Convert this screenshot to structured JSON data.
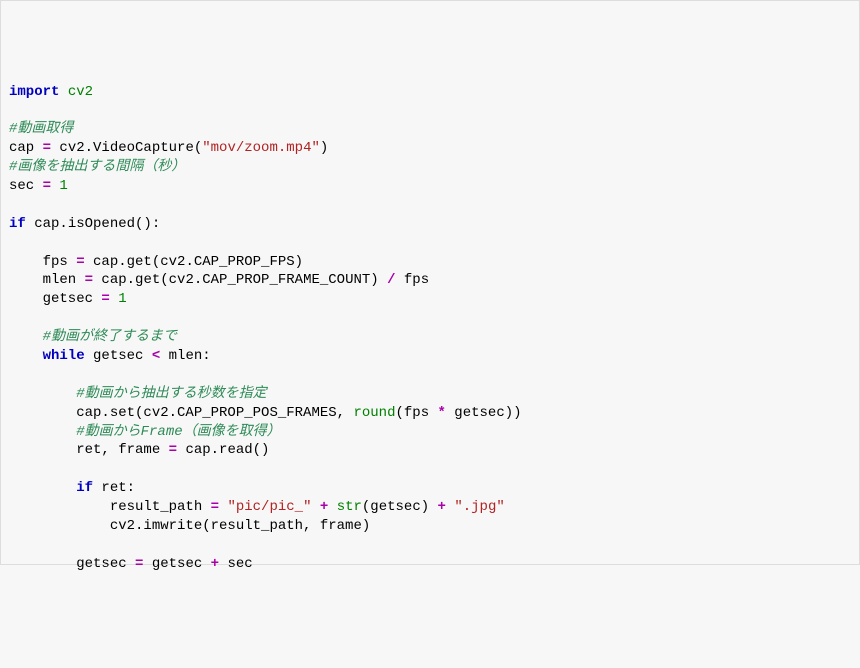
{
  "code": {
    "l1a": "import",
    "l1b": " cv2",
    "l2": "",
    "l3": "#動画取得",
    "l4a": "cap ",
    "l4b": "=",
    "l4c": " cv2.VideoCapture(",
    "l4d": "\"mov/zoom.mp4\"",
    "l4e": ")",
    "l5": "#画像を抽出する間隔（秒）",
    "l6a": "sec ",
    "l6b": "=",
    "l6c": " ",
    "l6d": "1",
    "l7": "",
    "l8a": "if",
    "l8b": " cap.isOpened():",
    "l9": "",
    "l10a": "    fps ",
    "l10b": "=",
    "l10c": " cap.get(cv2.CAP_PROP_FPS)",
    "l11a": "    mlen ",
    "l11b": "=",
    "l11c": " cap.get(cv2.CAP_PROP_FRAME_COUNT) ",
    "l11d": "/",
    "l11e": " fps",
    "l12a": "    getsec ",
    "l12b": "=",
    "l12c": " ",
    "l12d": "1",
    "l13": "",
    "l14": "    #動画が終了するまで",
    "l15a": "    ",
    "l15b": "while",
    "l15c": " getsec ",
    "l15d": "<",
    "l15e": " mlen:",
    "l16": "",
    "l17": "        #動画から抽出する秒数を指定",
    "l18a": "        cap.set(cv2.CAP_PROP_POS_FRAMES, ",
    "l18b": "round",
    "l18c": "(fps ",
    "l18d": "*",
    "l18e": " getsec))",
    "l19": "        #動画からFrame（画像を取得）",
    "l20a": "        ret, frame ",
    "l20b": "=",
    "l20c": " cap.read()",
    "l21": "",
    "l22a": "        ",
    "l22b": "if",
    "l22c": " ret:",
    "l23a": "            result_path ",
    "l23b": "=",
    "l23c": " ",
    "l23d": "\"pic/pic_\"",
    "l23e": " ",
    "l23f": "+",
    "l23g": " ",
    "l23h": "str",
    "l23i": "(getsec) ",
    "l23j": "+",
    "l23k": " ",
    "l23l": "\".jpg\"",
    "l24": "            cv2.imwrite(result_path, frame)",
    "l25": "",
    "l26a": "        getsec ",
    "l26b": "=",
    "l26c": " getsec ",
    "l26d": "+",
    "l26e": " sec"
  }
}
